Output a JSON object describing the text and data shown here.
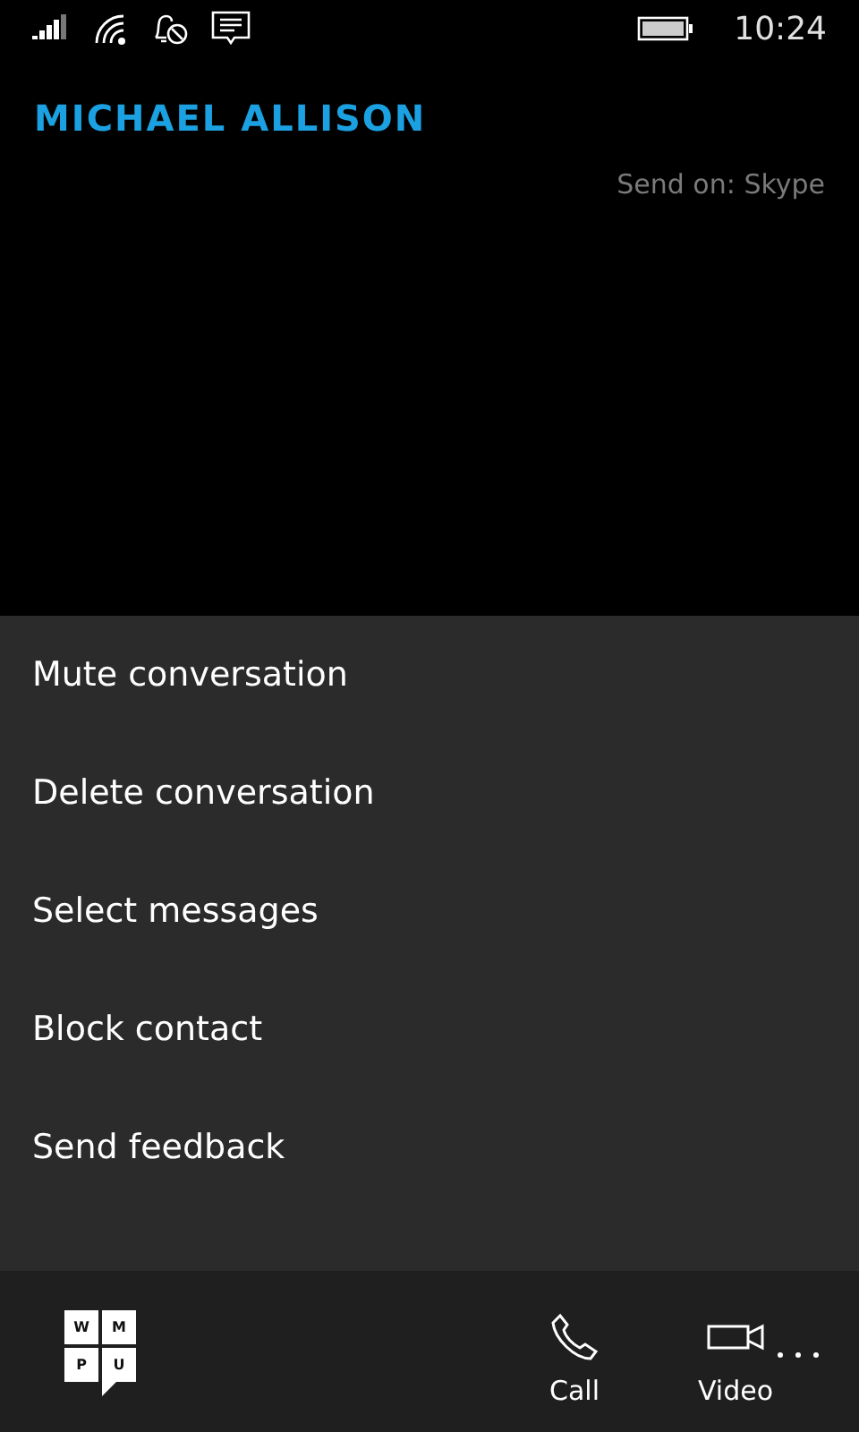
{
  "status_bar": {
    "time": "10:24"
  },
  "header": {
    "contact_name": "MICHAEL ALLISON",
    "send_on": "Send on: Skype"
  },
  "menu": {
    "items": [
      {
        "label": "Mute conversation"
      },
      {
        "label": "Delete conversation"
      },
      {
        "label": "Select messages"
      },
      {
        "label": "Block contact"
      },
      {
        "label": "Send feedback"
      }
    ]
  },
  "app_bar": {
    "logo_letters": [
      "W",
      "M",
      "P",
      "U"
    ],
    "buttons": [
      {
        "kind": "call",
        "label": "Call"
      },
      {
        "kind": "video",
        "label": "Video"
      }
    ]
  }
}
